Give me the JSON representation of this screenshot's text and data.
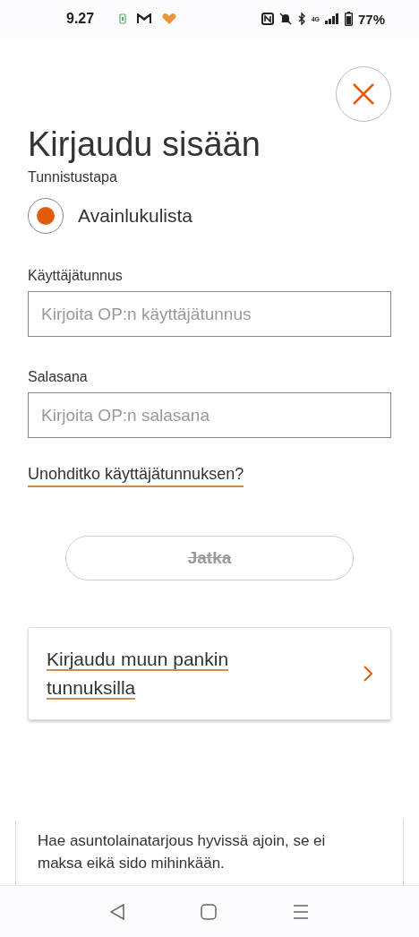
{
  "status_bar": {
    "time": "9.27",
    "network": "4G",
    "battery": "77%"
  },
  "title": "Kirjaudu sisään",
  "method": {
    "label": "Tunnistustapa",
    "options": [
      {
        "label": "Avainlukulista",
        "selected": true
      }
    ]
  },
  "fields": [
    {
      "label": "Käyttäjätunnus",
      "placeholder": "Kirjoita OP:n käyttäjätunnus"
    },
    {
      "label": "Salasana",
      "placeholder": "Kirjoita OP:n salasana"
    }
  ],
  "forgot_link": "Unohditko käyttäjätunnuksen?",
  "continue_button": {
    "label": "Jatka",
    "disabled": true
  },
  "other_bank": {
    "label": "Kirjaudu muun pankin tunnuksilla"
  },
  "promo": {
    "lines": [
      "Hae asuntolainatarjous hyvissä ajoin, se ei maksa eikä sido mihinkään."
    ]
  }
}
